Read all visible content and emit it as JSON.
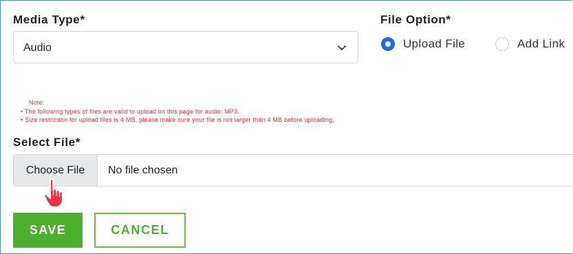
{
  "media_type": {
    "label": "Media Type*",
    "selected": "Audio"
  },
  "file_option": {
    "label": "File Option*",
    "options": [
      {
        "label": "Upload File",
        "selected": true
      },
      {
        "label": "Add Link",
        "selected": false
      }
    ]
  },
  "note": {
    "title": "Note:",
    "lines": [
      "• The following types of files are valid to upload on this page for audio: MP3.",
      "• Size restriction for upload files is 4 MB, please make sure your file is not larger than 4 MB before uploading."
    ]
  },
  "select_file": {
    "label": "Select File*",
    "button_label": "Choose File",
    "status": "No file chosen"
  },
  "actions": {
    "save_label": "SAVE",
    "cancel_label": "CANCEL"
  },
  "colors": {
    "accent_green": "#4caf2d",
    "radio_blue": "#1a6fd6",
    "note_red": "#e0313b",
    "cursor_red": "#e8343f"
  },
  "icons": {
    "dropdown": "chevron-down-icon",
    "cursor": "hand-pointer-icon"
  }
}
